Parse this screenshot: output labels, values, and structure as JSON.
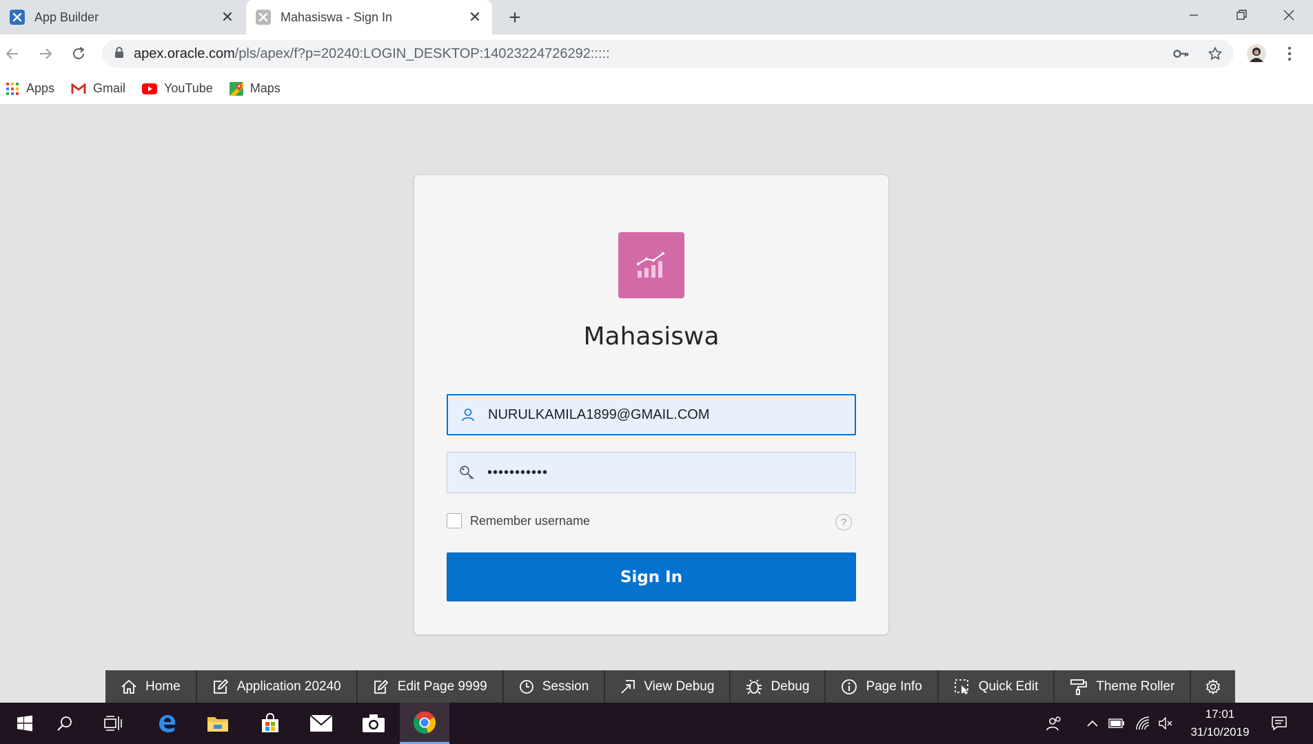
{
  "browser": {
    "tabs": [
      {
        "title": "App Builder",
        "active": false
      },
      {
        "title": "Mahasiswa - Sign In",
        "active": true
      }
    ],
    "url_host": "apex.oracle.com",
    "url_path": "/pls/apex/f?p=20240:LOGIN_DESKTOP:14023224726292:::::",
    "bookmarks": [
      "Apps",
      "Gmail",
      "YouTube",
      "Maps"
    ]
  },
  "login": {
    "app_name": "Mahasiswa",
    "username_value": "NURULKAMILA1899@GMAIL.COM",
    "password_masked": "•••••••••••",
    "remember_label": "Remember username",
    "help_glyph": "?",
    "sign_in_label": "Sign In"
  },
  "dev_toolbar": {
    "items": [
      "Home",
      "Application 20240",
      "Edit Page 9999",
      "Session",
      "View Debug",
      "Debug",
      "Page Info",
      "Quick Edit",
      "Theme Roller"
    ]
  },
  "taskbar": {
    "time": "17:01",
    "date": "31/10/2019"
  },
  "colors": {
    "accent": "#0572ce",
    "app_logo": "#d36aa8",
    "page_bg": "#e3e3e3",
    "devbar_bg": "#454545",
    "taskbar_bg": "#1f1420"
  }
}
